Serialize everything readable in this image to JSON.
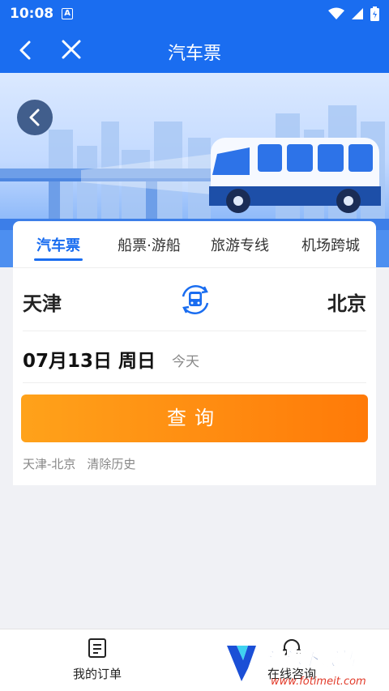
{
  "status_bar": {
    "time": "10:08",
    "notification_icon": "A"
  },
  "nav": {
    "title": "汽车票"
  },
  "tabs": [
    {
      "label": "汽车票",
      "active": true
    },
    {
      "label": "船票·游船",
      "active": false
    },
    {
      "label": "旅游专线",
      "active": false
    },
    {
      "label": "机场跨城",
      "active": false
    }
  ],
  "route": {
    "from": "天津",
    "to": "北京"
  },
  "date": {
    "value": "07月13日 周日",
    "hint": "今天"
  },
  "search": {
    "label": "查询"
  },
  "history": {
    "item": "天津-北京",
    "clear": "清除历史"
  },
  "bottom_nav": {
    "orders_label": "我的订单",
    "consult_label": "在线咨询"
  },
  "watermark": {
    "title": "清源下载站",
    "url": "www.fotimeit.com"
  },
  "colors": {
    "primary": "#1a6df0",
    "accent": "#ff8a10"
  }
}
